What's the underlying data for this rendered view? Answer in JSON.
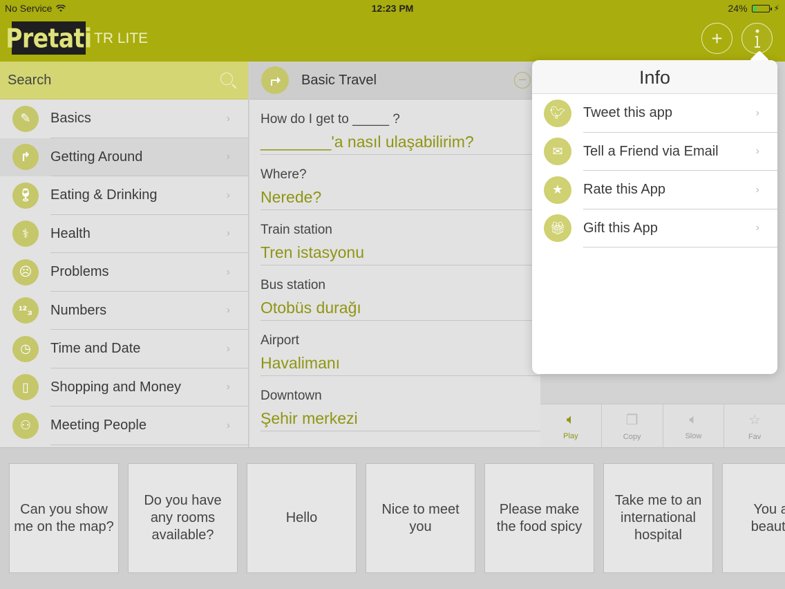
{
  "status_bar": {
    "carrier": "No Service",
    "time": "12:23 PM",
    "battery_percent": "24%",
    "battery_level": 0.24
  },
  "header": {
    "logo_text": "Pretati",
    "app_subtitle": "TR LITE"
  },
  "search": {
    "placeholder": "Search"
  },
  "categories": [
    {
      "label": "Basics",
      "icon": "pencil-icon"
    },
    {
      "label": "Getting Around",
      "icon": "turn-arrow-icon",
      "active": true
    },
    {
      "label": "Eating & Drinking",
      "icon": "glass-icon"
    },
    {
      "label": "Health",
      "icon": "stethoscope-icon"
    },
    {
      "label": "Problems",
      "icon": "sad-face-icon"
    },
    {
      "label": "Numbers",
      "icon": "numbers-icon"
    },
    {
      "label": "Time and Date",
      "icon": "clock-calendar-icon"
    },
    {
      "label": "Shopping and Money",
      "icon": "shopping-bag-icon"
    },
    {
      "label": "Meeting People",
      "icon": "people-icon"
    }
  ],
  "section": {
    "title": "Basic Travel"
  },
  "phrases": [
    {
      "en": "How do I get to _____ ?",
      "tr": "________'a nasıl ulaşabilirim?"
    },
    {
      "en": "Where?",
      "tr": "Nerede?"
    },
    {
      "en": "Train station",
      "tr": "Tren istasyonu"
    },
    {
      "en": "Bus station",
      "tr": "Otobüs durağı"
    },
    {
      "en": "Airport",
      "tr": "Havalimanı"
    },
    {
      "en": "Downtown",
      "tr": "Şehir merkezi"
    }
  ],
  "toolbar": {
    "play": "Play",
    "copy": "Copy",
    "slow": "Slow",
    "fav": "Fav"
  },
  "info_popover": {
    "title": "Info",
    "items": [
      {
        "label": "Tweet this app",
        "icon": "twitter-bird-icon"
      },
      {
        "label": "Tell a Friend via Email",
        "icon": "envelope-icon"
      },
      {
        "label": "Rate this App",
        "icon": "star-icon"
      },
      {
        "label": "Gift this App",
        "icon": "gift-icon"
      }
    ]
  },
  "quick_phrases": [
    "Can you show me on the map?",
    "Do you have any rooms available?",
    "Hello",
    "Nice to meet you",
    "Please make the food spicy",
    "Take me to an international hospital",
    "You are beautiful"
  ],
  "colors": {
    "brand_olive": "#a9ad0d",
    "accent_text": "#8f9512",
    "icon_circle": "#c5c76a"
  }
}
